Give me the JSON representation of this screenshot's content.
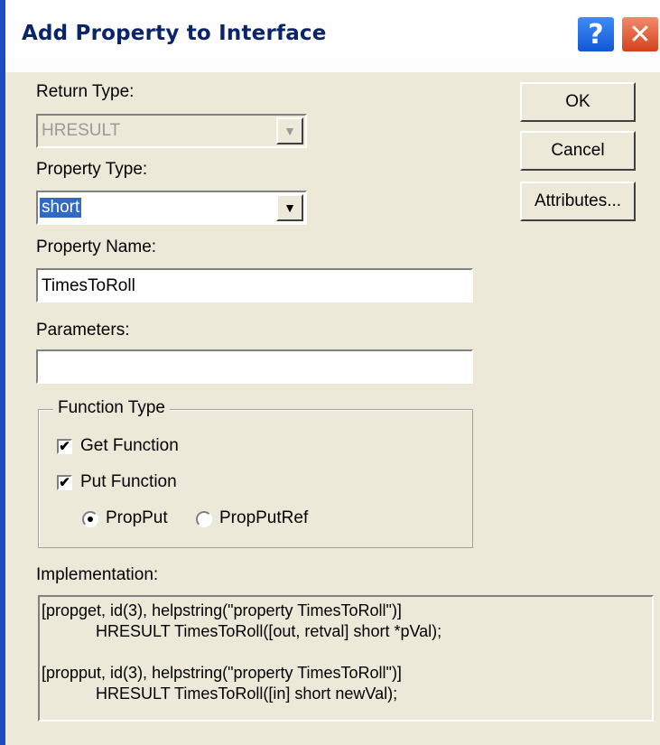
{
  "window": {
    "title": "Add Property to Interface",
    "help_glyph": "?",
    "close_glyph": "✕"
  },
  "return_type": {
    "label": "Return Type:",
    "value": "HRESULT"
  },
  "property_type": {
    "label": "Property Type:",
    "value": "short"
  },
  "property_name": {
    "label": "Property Name:",
    "value": "TimesToRoll"
  },
  "parameters": {
    "label": "Parameters:",
    "value": ""
  },
  "buttons": {
    "ok": "OK",
    "cancel": "Cancel",
    "attributes": "Attributes..."
  },
  "function_type": {
    "legend": "Function Type",
    "get": {
      "label": "Get Function",
      "checked": true
    },
    "put": {
      "label": "Put Function",
      "checked": true
    },
    "propput": {
      "label": "PropPut",
      "selected": true
    },
    "propputref": {
      "label": "PropPutRef",
      "selected": false
    }
  },
  "implementation": {
    "label": "Implementation:",
    "lines": [
      "[propget, id(3), helpstring(\"property TimesToRoll\")]",
      "            HRESULT TimesToRoll([out, retval] short *pVal);",
      "",
      "[propput, id(3), helpstring(\"property TimesToRoll\")]",
      "            HRESULT TimesToRoll([in] short newVal);"
    ]
  },
  "icons": {
    "dropdown": "▼",
    "check": "✔"
  }
}
